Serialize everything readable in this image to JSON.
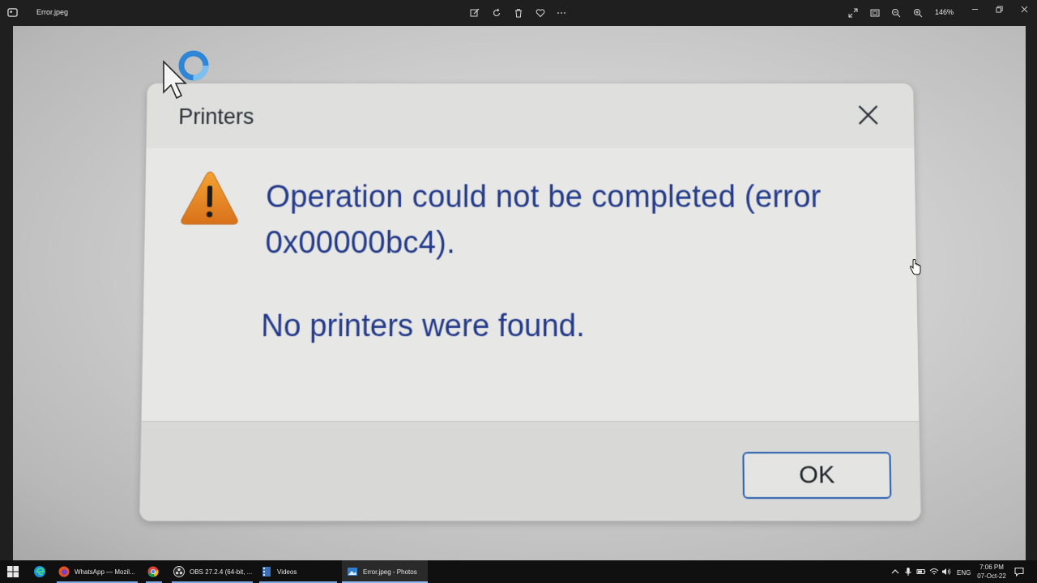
{
  "titlebar": {
    "file_name": "Error.jpeg",
    "zoom_level": "146%",
    "toolbar_icons": [
      "edit-icon",
      "rotate-icon",
      "delete-icon",
      "favorite-icon",
      "more-icon"
    ],
    "view_icons": [
      "fullscreen-icon",
      "fit-icon",
      "zoom-out-icon",
      "zoom-in-icon"
    ]
  },
  "photo": {
    "dialog_title": "Printers",
    "error_message": "Operation could not be completed (error 0x00000bc4).",
    "sub_message": "No printers were found.",
    "ok_label": "OK",
    "text_color": "#243a8a",
    "warning_color": "#e8871e"
  },
  "taskbar": {
    "apps": [
      {
        "label": "WhatsApp — Mozil...",
        "icon": "firefox-icon"
      },
      {
        "label": "",
        "icon": "chrome-icon"
      },
      {
        "label": "OBS 27.2.4 (64-bit, ...",
        "icon": "obs-icon"
      },
      {
        "label": "Videos",
        "icon": "videos-icon"
      },
      {
        "label": "Error.jpeg - Photos",
        "icon": "photos-icon"
      }
    ],
    "tray": {
      "language": "ENG",
      "time": "7:06 PM",
      "date": "07-Oct-22"
    }
  }
}
